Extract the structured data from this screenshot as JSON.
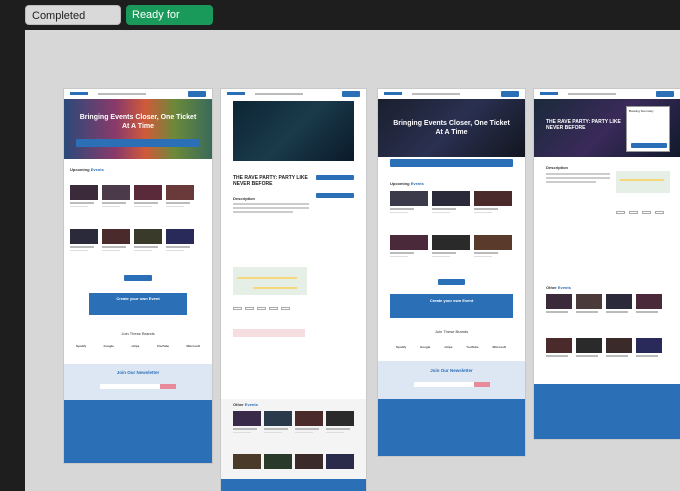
{
  "toolbar": {
    "completed_label": "Completed screens",
    "ready_label": "Ready for dev",
    "ready_icon": "code-icon"
  },
  "screens": {
    "home": {
      "hero_title": "Bringing Events Closer, One Ticket At A Time",
      "upcoming_title": "Upcoming",
      "upcoming_accent": "Events",
      "banner_title": "Create your own Event",
      "partners_title": "Join These Brands",
      "partners": [
        "Spotify",
        "Google",
        "stripe",
        "YouTube",
        "Microsoft"
      ],
      "newsletter_title": "Join Our Newsletter"
    },
    "detail": {
      "event_title": "THE RAVE PARTY: PARTY LIKE NEVER BEFORE",
      "description_label": "Description",
      "other_events_title": "Other",
      "other_events_accent": "Events"
    },
    "home_alt": {
      "hero_title": "Bringing Events Closer, One Ticket At A Time",
      "upcoming_title": "Upcoming",
      "upcoming_accent": "Events",
      "banner_title": "Create your own Event",
      "partners_title": "Join These Brands",
      "partners": [
        "Spotify",
        "Google",
        "stripe",
        "YouTube",
        "Microsoft"
      ],
      "newsletter_title": "Join Our Newsletter"
    },
    "detail_alt": {
      "event_title": "THE RAVE PARTY: PARTY LIKE NEVER BEFORE",
      "description_label": "Description",
      "other_events_title": "Other",
      "other_events_accent": "Events",
      "booking_label": "Booking Summary"
    }
  },
  "colors": {
    "brand_blue": "#2b6fb7",
    "ready_green": "#1a9a5a",
    "canvas_gray": "#d7d7d7"
  }
}
